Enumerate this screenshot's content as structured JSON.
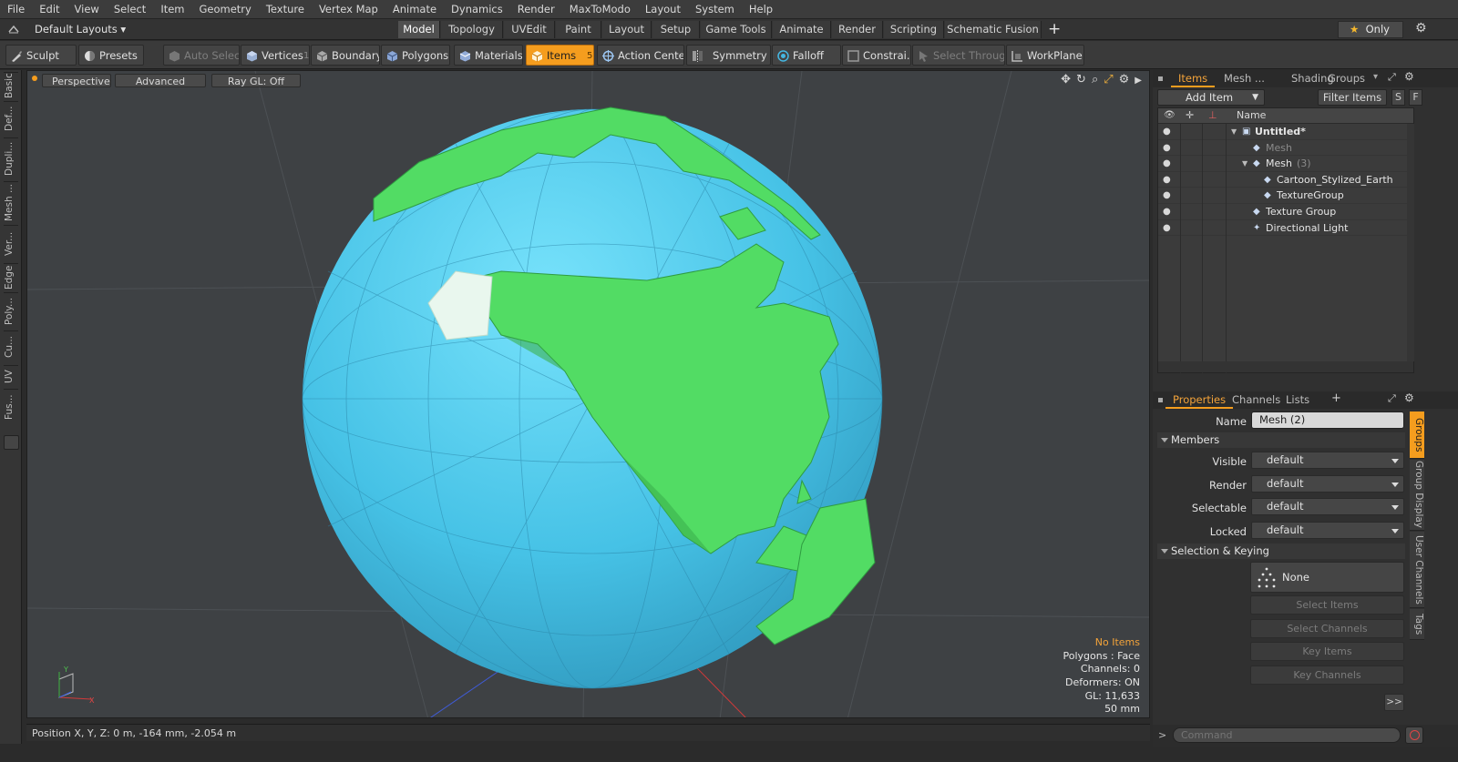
{
  "menu": [
    "File",
    "Edit",
    "View",
    "Select",
    "Item",
    "Geometry",
    "Texture",
    "Vertex Map",
    "Animate",
    "Dynamics",
    "Render",
    "MaxToModo",
    "Layout",
    "System",
    "Help"
  ],
  "layout_selector": "Default Layouts",
  "layout_tabs": [
    "Model",
    "Topology",
    "UVEdit",
    "Paint",
    "Layout",
    "Setup",
    "Game Tools",
    "Animate",
    "Render",
    "Scripting",
    "Schematic Fusion"
  ],
  "only_label": "Only",
  "toolbar": {
    "sculpt": "Sculpt",
    "presets": "Presets",
    "auto_select": "Auto Select",
    "vertices": "Vertices",
    "vertices_count": "1",
    "boundary": "Boundary",
    "polygons": "Polygons",
    "materials": "Materials",
    "items": "Items",
    "items_count": "5",
    "action_center": "Action Center",
    "symmetry": "Symmetry",
    "falloff": "Falloff",
    "constraints": "Constrai...",
    "select_through": "Select Through",
    "workplane": "WorkPlane"
  },
  "left_tabs": [
    "Basic",
    "Def...",
    "Dupli...",
    "Mesh ...",
    "Ver...",
    "Edge",
    "Poly...",
    "Cu...",
    "UV",
    "Fus..."
  ],
  "viewport": {
    "perspective": "Perspective",
    "advanced": "Advanced",
    "raygl": "Ray GL: Off",
    "info": {
      "no_items": "No Items",
      "polygons": "Polygons : Face",
      "channels": "Channels: 0",
      "deformers": "Deformers: ON",
      "gl": "GL: 11,633",
      "unit": "50 mm"
    }
  },
  "status": "Position X, Y, Z:  0 m, -164 mm, -2.054 m",
  "items_panel": {
    "tabs": [
      "Items",
      "Mesh ...",
      "Shading",
      "Groups"
    ],
    "add_item": "Add Item",
    "filter_items": "Filter Items",
    "s_btn": "S",
    "f_btn": "F",
    "col_name": "Name",
    "rows": [
      {
        "name": "Untitled*",
        "extra": "",
        "indent": 0,
        "bold": true,
        "dim": false
      },
      {
        "name": "Mesh",
        "extra": "",
        "indent": 1,
        "bold": false,
        "dim": true
      },
      {
        "name": "Mesh",
        "extra": "(3)",
        "indent": 1,
        "bold": false,
        "dim": false
      },
      {
        "name": "Cartoon_Stylized_Earth",
        "extra": "",
        "indent": 2,
        "bold": false,
        "dim": false
      },
      {
        "name": "TextureGroup",
        "extra": "",
        "indent": 2,
        "bold": false,
        "dim": false
      },
      {
        "name": "Texture Group",
        "extra": "",
        "indent": 1,
        "bold": false,
        "dim": false
      },
      {
        "name": "Directional Light",
        "extra": "",
        "indent": 1,
        "bold": false,
        "dim": false
      }
    ]
  },
  "properties_panel": {
    "tabs": [
      "Properties",
      "Channels",
      "Lists"
    ],
    "name_label": "Name",
    "name_value": "Mesh (2)",
    "members_header": "Members",
    "fields": [
      {
        "label": "Visible",
        "value": "default"
      },
      {
        "label": "Render",
        "value": "default"
      },
      {
        "label": "Selectable",
        "value": "default"
      },
      {
        "label": "Locked",
        "value": "default"
      }
    ],
    "selection_header": "Selection & Keying",
    "none_label": "None",
    "buttons": [
      "Select Items",
      "Select Channels",
      "Key Items",
      "Key Channels"
    ],
    "more": ">>",
    "side_tabs": [
      "Groups",
      "Group Display",
      "User Channels",
      "Tags"
    ]
  },
  "command_placeholder": "Command",
  "colors": {
    "accent": "#f59d1e",
    "ocean": "#4cc3e8",
    "land": "#52dc64"
  }
}
